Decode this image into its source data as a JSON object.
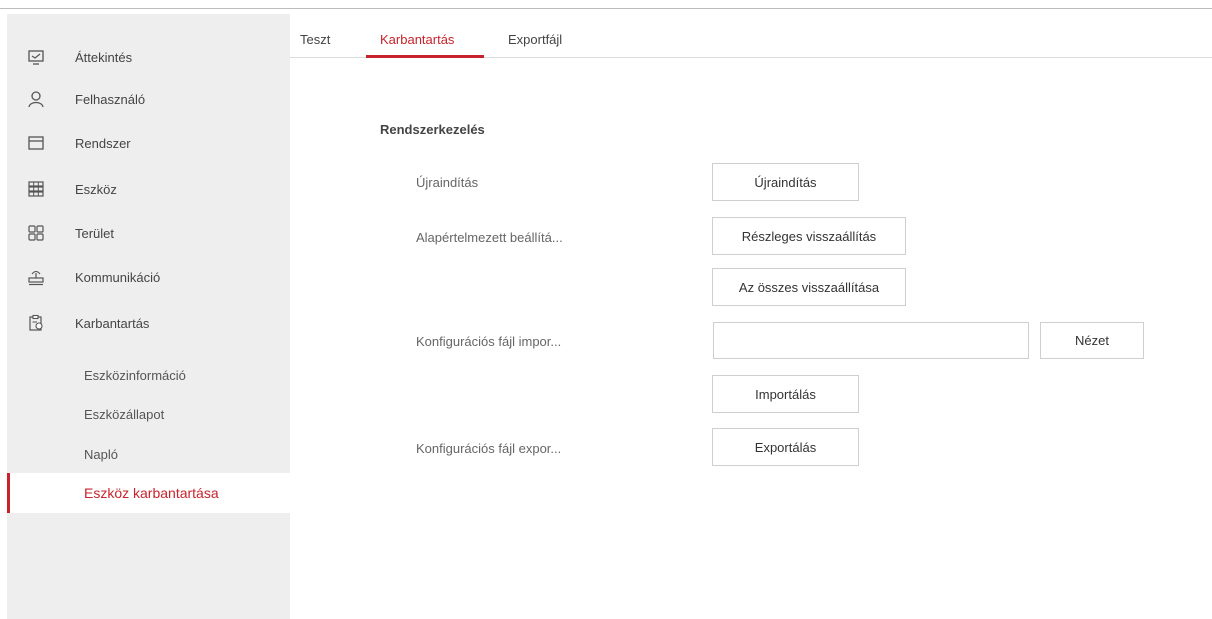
{
  "sidebar": {
    "items": [
      {
        "label": "Áttekintés",
        "icon": "monitor-icon"
      },
      {
        "label": "Felhasználó",
        "icon": "user-icon"
      },
      {
        "label": "Rendszer",
        "icon": "window-icon"
      },
      {
        "label": "Eszköz",
        "icon": "device-grid-icon"
      },
      {
        "label": "Terület",
        "icon": "four-squares-icon"
      },
      {
        "label": "Kommunikáció",
        "icon": "router-icon"
      },
      {
        "label": "Karbantartás",
        "icon": "maintenance-icon"
      }
    ],
    "sub_items": [
      {
        "label": "Eszközinformáció"
      },
      {
        "label": "Eszközállapot"
      },
      {
        "label": "Napló"
      },
      {
        "label": "Eszköz karbantartása"
      }
    ]
  },
  "tabs": [
    {
      "label": "Teszt"
    },
    {
      "label": "Karbantartás"
    },
    {
      "label": "Exportfájl"
    }
  ],
  "main": {
    "section_title": "Rendszerkezelés",
    "rows": {
      "reboot_label": "Újraindítás",
      "reboot_button": "Újraindítás",
      "default_label": "Alapértelmezett beállítá...",
      "partial_restore_button": "Részleges visszaállítás",
      "full_restore_button": "Az összes visszaállítása",
      "import_label": "Konfigurációs fájl impor...",
      "import_file_value": "",
      "browse_button": "Nézet",
      "import_button": "Importálás",
      "export_label": "Konfigurációs fájl expor...",
      "export_button": "Exportálás"
    }
  },
  "colors": {
    "accent": "#c8232c",
    "sidebar_bg": "#eeeeee"
  }
}
